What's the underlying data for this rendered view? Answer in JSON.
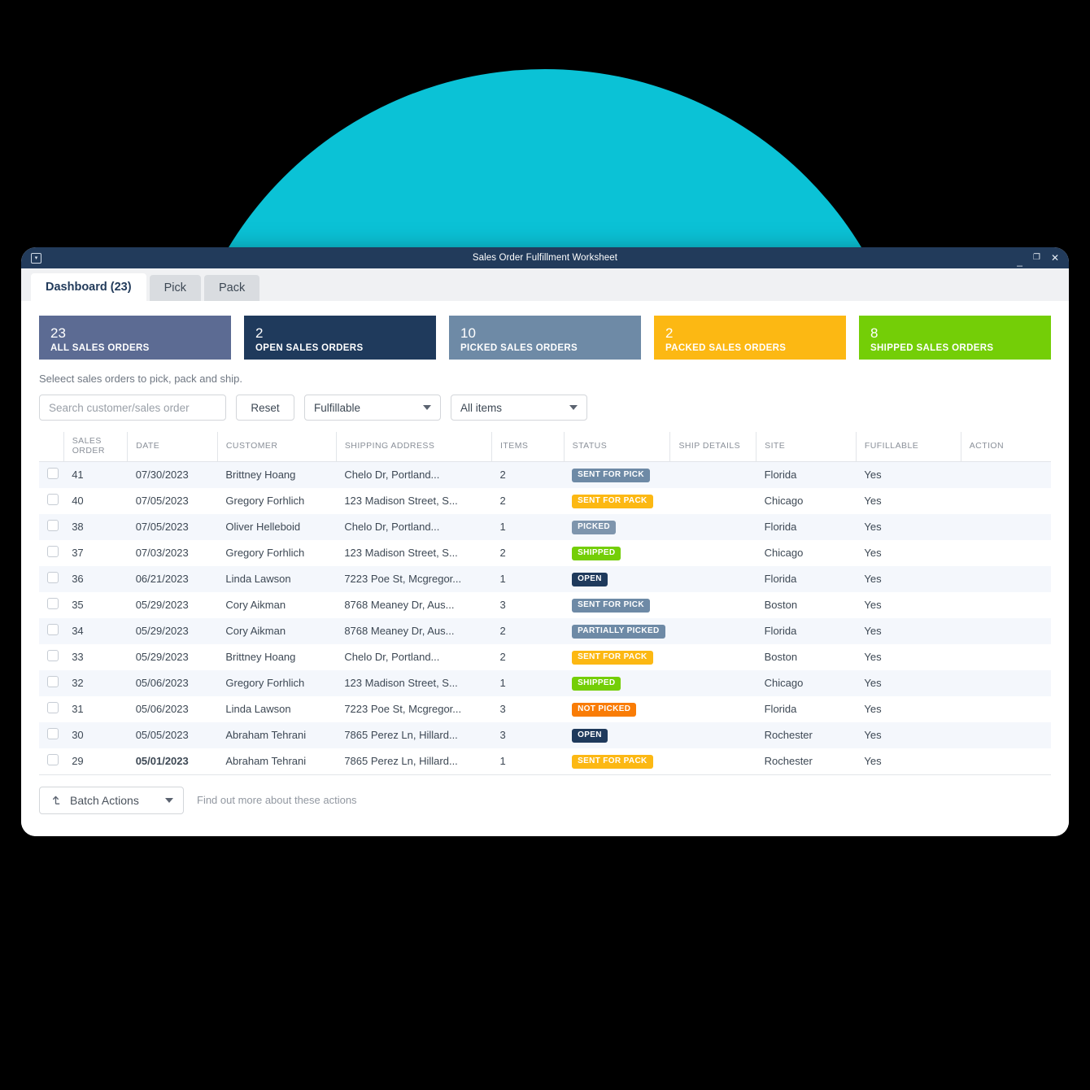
{
  "window": {
    "title": "Sales Order Fulfillment Worksheet",
    "app_icon": "window-app-icon",
    "minimize": "—",
    "maximize": "☐",
    "close": "×"
  },
  "tabs": [
    {
      "label": "Dashboard (23)",
      "active": true
    },
    {
      "label": "Pick",
      "active": false
    },
    {
      "label": "Pack",
      "active": false
    }
  ],
  "kpis": [
    {
      "value": "23",
      "label": "ALL SALES ORDERS",
      "color": "#5C6B93"
    },
    {
      "value": "2",
      "label": "OPEN SALES ORDERS",
      "color": "#1F3A5C"
    },
    {
      "value": "10",
      "label": "PICKED SALES ORDERS",
      "color": "#6E8AA6"
    },
    {
      "value": "2",
      "label": "PACKED SALES ORDERS",
      "color": "#FCB813"
    },
    {
      "value": "8",
      "label": "SHIPPED SALES ORDERS",
      "color": "#74CE07"
    }
  ],
  "helper_text": "Seleect sales orders to pick, pack and ship.",
  "filters": {
    "search_placeholder": "Search customer/sales order",
    "search_value": "",
    "reset_label": "Reset",
    "fulfillable_selected": "Fulfillable",
    "items_selected": "All items"
  },
  "table": {
    "headers": [
      "SALES ORDER",
      "DATE",
      "CUSTOMER",
      "SHIPPING ADDRESS",
      "ITEMS",
      "STATUS",
      "SHIP DETAILS",
      "SITE",
      "FUFILLABLE",
      "ACTION"
    ],
    "rows": [
      {
        "sales_order": "41",
        "date": "07/30/2023",
        "date_bold": false,
        "customer": "Brittney Hoang",
        "address": "Chelo Dr, Portland...",
        "items": "2",
        "status": "SENT FOR PICK",
        "status_class": "b-sent-pick",
        "ship_details": "",
        "site": "Florida",
        "fulfillable": "Yes",
        "action": ""
      },
      {
        "sales_order": "40",
        "date": "07/05/2023",
        "date_bold": false,
        "customer": "Gregory Forhlich",
        "address": "123 Madison Street, S...",
        "items": "2",
        "status": "SENT FOR PACK",
        "status_class": "b-sent-pack",
        "ship_details": "",
        "site": "Chicago",
        "fulfillable": "Yes",
        "action": ""
      },
      {
        "sales_order": "38",
        "date": "07/05/2023",
        "date_bold": false,
        "customer": "Oliver Helleboid",
        "address": "Chelo Dr, Portland...",
        "items": "1",
        "status": "PICKED",
        "status_class": "b-picked",
        "ship_details": "",
        "site": "Florida",
        "fulfillable": "Yes",
        "action": ""
      },
      {
        "sales_order": "37",
        "date": "07/03/2023",
        "date_bold": false,
        "customer": "Gregory Forhlich",
        "address": "123 Madison Street, S...",
        "items": "2",
        "status": "SHIPPED",
        "status_class": "b-shipped",
        "ship_details": "",
        "site": "Chicago",
        "fulfillable": "Yes",
        "action": ""
      },
      {
        "sales_order": "36",
        "date": "06/21/2023",
        "date_bold": false,
        "customer": "Linda Lawson",
        "address": "7223 Poe St, Mcgregor...",
        "items": "1",
        "status": "OPEN",
        "status_class": "b-open",
        "ship_details": "",
        "site": "Florida",
        "fulfillable": "Yes",
        "action": ""
      },
      {
        "sales_order": "35",
        "date": "05/29/2023",
        "date_bold": false,
        "customer": "Cory Aikman",
        "address": "8768 Meaney Dr, Aus...",
        "items": "3",
        "status": "SENT FOR PICK",
        "status_class": "b-sent-pick",
        "ship_details": "",
        "site": "Boston",
        "fulfillable": "Yes",
        "action": ""
      },
      {
        "sales_order": "34",
        "date": "05/29/2023",
        "date_bold": false,
        "customer": "Cory Aikman",
        "address": "8768 Meaney Dr, Aus...",
        "items": "2",
        "status": "PARTIALLY PICKED",
        "status_class": "b-part-pick",
        "ship_details": "",
        "site": "Florida",
        "fulfillable": "Yes",
        "action": ""
      },
      {
        "sales_order": "33",
        "date": "05/29/2023",
        "date_bold": false,
        "customer": "Brittney Hoang",
        "address": "Chelo Dr, Portland...",
        "items": "2",
        "status": "SENT FOR PACK",
        "status_class": "b-sent-pack",
        "ship_details": "",
        "site": "Boston",
        "fulfillable": "Yes",
        "action": ""
      },
      {
        "sales_order": "32",
        "date": "05/06/2023",
        "date_bold": false,
        "customer": "Gregory Forhlich",
        "address": "123 Madison Street, S...",
        "items": "1",
        "status": "SHIPPED",
        "status_class": "b-shipped",
        "ship_details": "",
        "site": "Chicago",
        "fulfillable": "Yes",
        "action": ""
      },
      {
        "sales_order": "31",
        "date": "05/06/2023",
        "date_bold": false,
        "customer": "Linda Lawson",
        "address": "7223 Poe St, Mcgregor...",
        "items": "3",
        "status": "NOT PICKED",
        "status_class": "b-not-picked",
        "ship_details": "",
        "site": "Florida",
        "fulfillable": "Yes",
        "action": ""
      },
      {
        "sales_order": "30",
        "date": "05/05/2023",
        "date_bold": false,
        "customer": "Abraham Tehrani",
        "address": "7865 Perez Ln, Hillard...",
        "items": "3",
        "status": "OPEN",
        "status_class": "b-open",
        "ship_details": "",
        "site": "Rochester",
        "fulfillable": "Yes",
        "action": ""
      },
      {
        "sales_order": "29",
        "date": "05/01/2023",
        "date_bold": true,
        "customer": "Abraham Tehrani",
        "address": "7865 Perez Ln, Hillard...",
        "items": "1",
        "status": "SENT FOR PACK",
        "status_class": "b-sent-pack",
        "ship_details": "",
        "site": "Rochester",
        "fulfillable": "Yes",
        "action": ""
      }
    ]
  },
  "footer": {
    "batch_actions_label": "Batch Actions",
    "find_out_more": "Find out more about these actions"
  },
  "theme": {
    "background": "#000000",
    "circle": "#0BC2D6",
    "titlebar": "#223B5B",
    "row_alt": "#F4F7FC"
  }
}
